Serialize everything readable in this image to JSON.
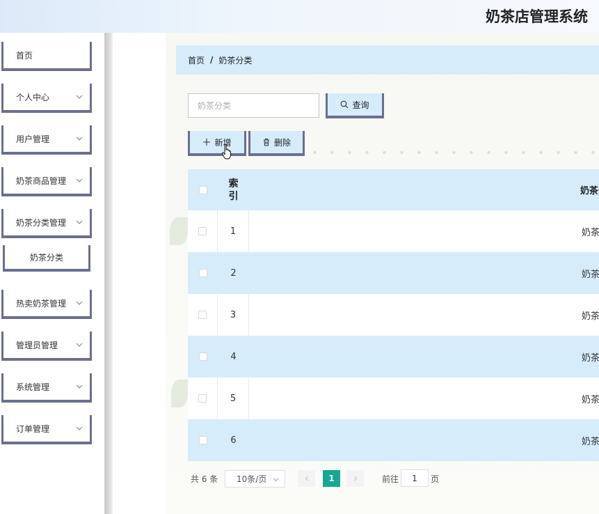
{
  "header": {
    "title": "奶茶店管理系统"
  },
  "sidebar": {
    "items": [
      {
        "label": "首页",
        "has_arrow": false
      },
      {
        "label": "个人中心",
        "has_arrow": true
      },
      {
        "label": "用户管理",
        "has_arrow": true
      },
      {
        "label": "奶茶商品管理",
        "has_arrow": true
      },
      {
        "label": "奶茶分类管理",
        "has_arrow": true,
        "expanded": true
      },
      {
        "label": "奶茶分类",
        "sub": true
      },
      {
        "label": "热卖奶茶管理",
        "has_arrow": true
      },
      {
        "label": "管理员管理",
        "has_arrow": true
      },
      {
        "label": "系统管理",
        "has_arrow": true
      },
      {
        "label": "订单管理",
        "has_arrow": true
      }
    ]
  },
  "breadcrumb": {
    "home": "首页",
    "separator": "/",
    "current": "奶茶分类"
  },
  "search": {
    "placeholder": "奶茶分类",
    "value": "",
    "button_label": "查询"
  },
  "toolbar": {
    "add_label": "新增",
    "delete_label": "删除"
  },
  "table": {
    "headers": {
      "index_line1": "索",
      "index_line2": "引",
      "name": "奶茶分"
    },
    "rows": [
      {
        "index": "1",
        "name": "奶茶分"
      },
      {
        "index": "2",
        "name": "奶茶分"
      },
      {
        "index": "3",
        "name": "奶茶分"
      },
      {
        "index": "4",
        "name": "奶茶分"
      },
      {
        "index": "5",
        "name": "奶茶分"
      },
      {
        "index": "6",
        "name": "奶茶分"
      }
    ]
  },
  "pagination": {
    "total": "共 6 条",
    "page_size": "10条/页",
    "current_page": "1",
    "goto_prefix": "前往",
    "goto_value": "1",
    "goto_suffix": "页"
  },
  "colors": {
    "accent": "#d6ecfb",
    "border": "#6b6f8e",
    "active_page": "#16a893"
  }
}
